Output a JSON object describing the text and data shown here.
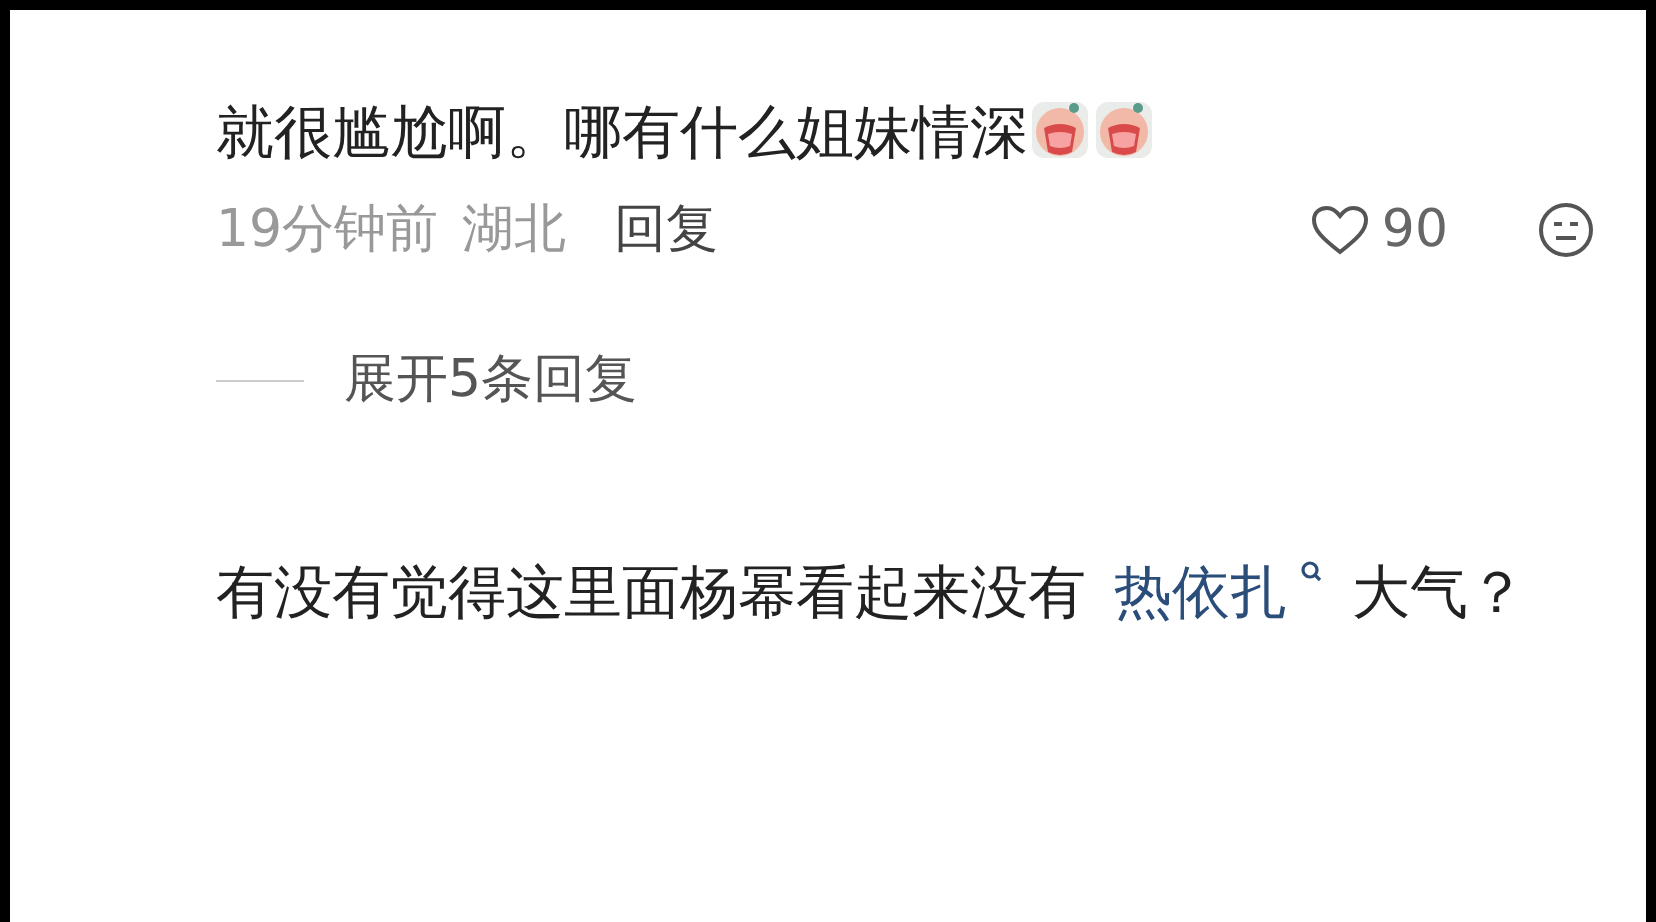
{
  "comments": [
    {
      "parts": [
        {
          "kind": "text",
          "text": "就很尴尬啊。哪有什么姐妹情深"
        },
        {
          "kind": "sticker"
        },
        {
          "kind": "sticker"
        }
      ],
      "time": "19分钟前",
      "location": "湖北",
      "reply": "回复",
      "likes": "90",
      "liked": false,
      "expand": "展开5条回复"
    },
    {
      "parts": [
        {
          "kind": "text",
          "text": "有没有觉得这里面杨幂看起来没有"
        },
        {
          "kind": "link",
          "text": "热依扎"
        },
        {
          "kind": "text",
          "text": "大气？"
        }
      ]
    }
  ]
}
